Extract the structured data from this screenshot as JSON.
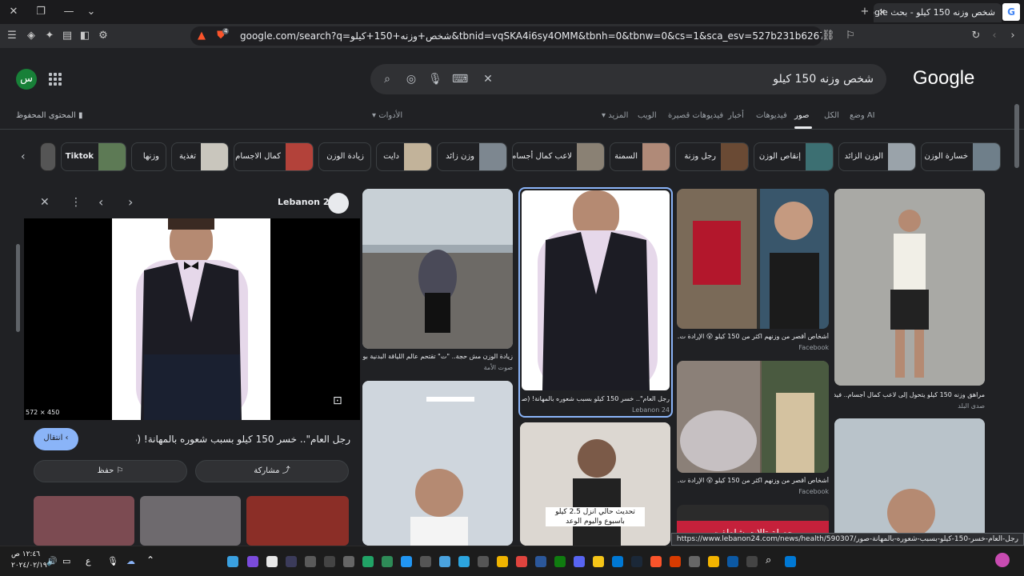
{
  "browser": {
    "tab_title": "شخص وزنه 150 كيلو - بحث Google",
    "url": "google.com/search?q=شخص+وزنه+150+كيلو&tbnid=vqSKA4i6sy4OMM&tbnh=0&tbnw=0&cs=1&sca_esv=527b231b6267b91a&udm=2&biw=1699&bi...",
    "brave_badge": "4"
  },
  "search": {
    "query": "شخص وزنه 150 كيلو",
    "logo": "Google",
    "avatar_letter": "س"
  },
  "tabs": [
    "وضع AI",
    "الكل",
    "صور",
    "فيديوهات",
    "أخبار",
    "فيديوهات قصيرة",
    "الويب",
    "المزيد",
    "الأدوات"
  ],
  "saved_content": "المحتوى المحفوظ",
  "chips": [
    "خسارة الوزن",
    "الوزن الزائد",
    "إنقاص الوزن",
    "رجل وزنة",
    "السمنة",
    "لاعب كمال أجسام",
    "وزن زائد",
    "دايت",
    "زيادة الوزن",
    "كمال الاجسام",
    "تغذية",
    "وزنها",
    "Tiktok"
  ],
  "preview": {
    "source": "Lebanon 24",
    "dimensions": "572 × 450",
    "title": "رجل العام\".. خسر 150 كيلو بسبب شعوره بالمهانة! (صور)",
    "visit_button": "انتقال",
    "share_button": "مشاركة",
    "save_button": "حفظ"
  },
  "results": [
    {
      "caption": "زيادة الوزن مش حجة.. \"ت\" تقتحم عالم اللياقة البدنية بوزن يزي...",
      "source": "صوت الأمة"
    },
    {
      "caption": "رجل العام\".. خسر 150 كيلو بسبب شعوره بالمهانة! (صور)",
      "source": "Lebanon 24"
    },
    {
      "caption": "أشخاص أقصر من وزنهم اكثر من 150 كيلو 😮 الإرادة ت...",
      "source": "Facebook"
    },
    {
      "caption": "مراهق وزنه 150 كيلو يتحول إلى لاعب كمال أجسام.. فيديو...",
      "source": "صدى البلد"
    },
    {
      "caption": "أشخاص أقصر من وزنهم اكثر من 150 كيلو 😮 الإرادة ت...",
      "source": "Facebook"
    },
    {
      "caption": "تحديث حالي انزل 2.5 كيلو باسبوع واليوم الوعد",
      "source": ""
    },
    {
      "caption": "حصلة تالات شاطفت",
      "source": ""
    }
  ],
  "status_url": "https://www.lebanon24.com/news/health/590307/رجل-العام-خسر-150-كيلو-بسبب-شعوره-بالمهانة-صور",
  "taskbar": {
    "time": "١٢:٤٦ ص",
    "date": "٢٠٢٤/٠٢/١٩",
    "lang": "ع"
  },
  "colors": {
    "accent": "#8ab4f8",
    "background": "#202124",
    "avatar": "#188038"
  }
}
